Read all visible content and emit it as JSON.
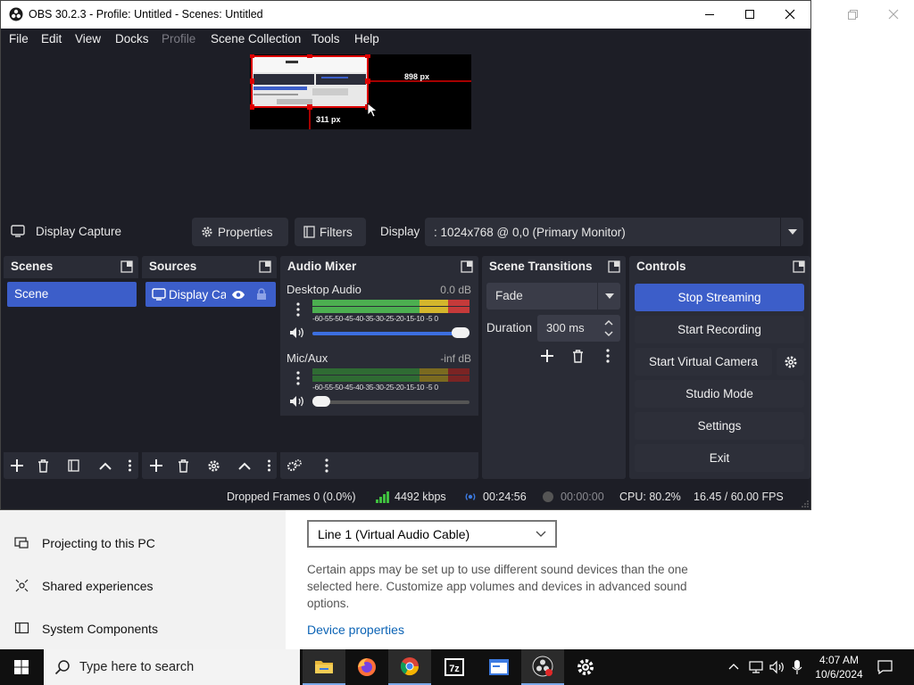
{
  "obs": {
    "title": "OBS 30.2.3 - Profile: Untitled - Scenes: Untitled",
    "menu": [
      "File",
      "Edit",
      "View",
      "Docks",
      "Profile",
      "Scene Collection",
      "Tools",
      "Help"
    ],
    "preview": {
      "label_width": "898 px",
      "label_height": "311 px"
    },
    "source_bar": {
      "source_name": "Display Capture",
      "properties": "Properties",
      "filters": "Filters",
      "display_label": "Display",
      "display_value": ": 1024x768 @ 0,0 (Primary Monitor)"
    },
    "scenes": {
      "title": "Scenes",
      "items": [
        "Scene"
      ]
    },
    "sources": {
      "title": "Sources",
      "items": [
        "Display Capture"
      ]
    },
    "mixer": {
      "title": "Audio Mixer",
      "ticks": "-60-55-50-45-40-35-30-25-20-15-10 -5  0",
      "channels": [
        {
          "name": "Desktop Audio",
          "db": "0.0 dB",
          "level": 1.0
        },
        {
          "name": "Mic/Aux",
          "db": "-inf dB",
          "level": 0.0
        }
      ]
    },
    "transitions": {
      "title": "Scene Transitions",
      "type": "Fade",
      "duration_label": "Duration",
      "duration_value": "300 ms"
    },
    "controls": {
      "title": "Controls",
      "stop_streaming": "Stop Streaming",
      "start_recording": "Start Recording",
      "start_virtual_camera": "Start Virtual Camera",
      "studio_mode": "Studio Mode",
      "settings": "Settings",
      "exit": "Exit"
    },
    "status": {
      "dropped_frames": "Dropped Frames 0 (0.0%)",
      "bitrate": "4492 kbps",
      "stream_time": "00:24:56",
      "record_time": "00:00:00",
      "cpu": "CPU: 80.2%",
      "fps": "16.45 / 60.00 FPS"
    }
  },
  "settings_window": {
    "nav": [
      "Projecting to this PC",
      "Shared experiences",
      "System Components"
    ],
    "output_device": "Line 1 (Virtual Audio Cable)",
    "description": "Certain apps may be set up to use different sound devices than the one selected here. Customize app volumes and devices in advanced sound options.",
    "link": "Device properties"
  },
  "taskbar": {
    "search_placeholder": "Type here to search",
    "time": "4:07 AM",
    "date": "10/6/2024"
  },
  "colors": {
    "accent": "#3c5ec9",
    "obs_bg": "#1d1e26",
    "panel": "#2a2c36"
  }
}
